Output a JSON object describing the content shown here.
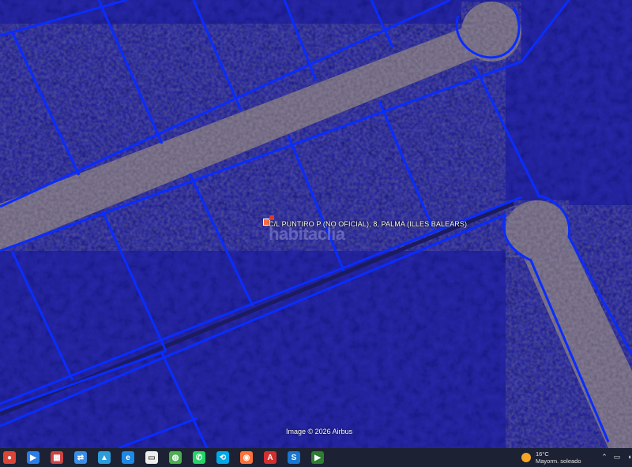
{
  "map": {
    "location_label": "C/L PUNTIRO P (NO OFICIAL), 8, PALMA (ILLES BALEARS)",
    "watermark": "habitaclia",
    "attribution": "Image © 2026 Airbus",
    "colors": {
      "overlay": "#1f1fa0",
      "parcel_line": "#0a2cff",
      "road": "#b8a98a",
      "pin": "#ff6a3a"
    }
  },
  "taskbar": {
    "apps": [
      {
        "name": "chrome-icon",
        "color": "#db4437",
        "glyph": "●"
      },
      {
        "name": "media-icon",
        "color": "#2b7de9",
        "glyph": "▶"
      },
      {
        "name": "folder-slides-icon",
        "color": "#c44",
        "glyph": "▦"
      },
      {
        "name": "network-icon",
        "color": "#3a8ee6",
        "glyph": "⇄"
      },
      {
        "name": "photos-icon",
        "color": "#2d9cdb",
        "glyph": "▲"
      },
      {
        "name": "edge-icon",
        "color": "#1e88e5",
        "glyph": "e"
      },
      {
        "name": "document-icon",
        "color": "#eeeeee",
        "glyph": "▭"
      },
      {
        "name": "globe-icon",
        "color": "#4caf50",
        "glyph": "◍"
      },
      {
        "name": "whatsapp-icon",
        "color": "#25d366",
        "glyph": "✆"
      },
      {
        "name": "teamviewer-icon",
        "color": "#00a8e8",
        "glyph": "⟲"
      },
      {
        "name": "firefox-icon",
        "color": "#ff7139",
        "glyph": "◉"
      },
      {
        "name": "acrobat-icon",
        "color": "#d32f2f",
        "glyph": "A"
      },
      {
        "name": "sync-icon",
        "color": "#1976d2",
        "glyph": "S"
      },
      {
        "name": "spreadsheet-icon",
        "color": "#2e7d32",
        "glyph": "▶"
      }
    ],
    "weather": {
      "temperature": "16°C",
      "condition": "Mayorm. soleado"
    }
  }
}
